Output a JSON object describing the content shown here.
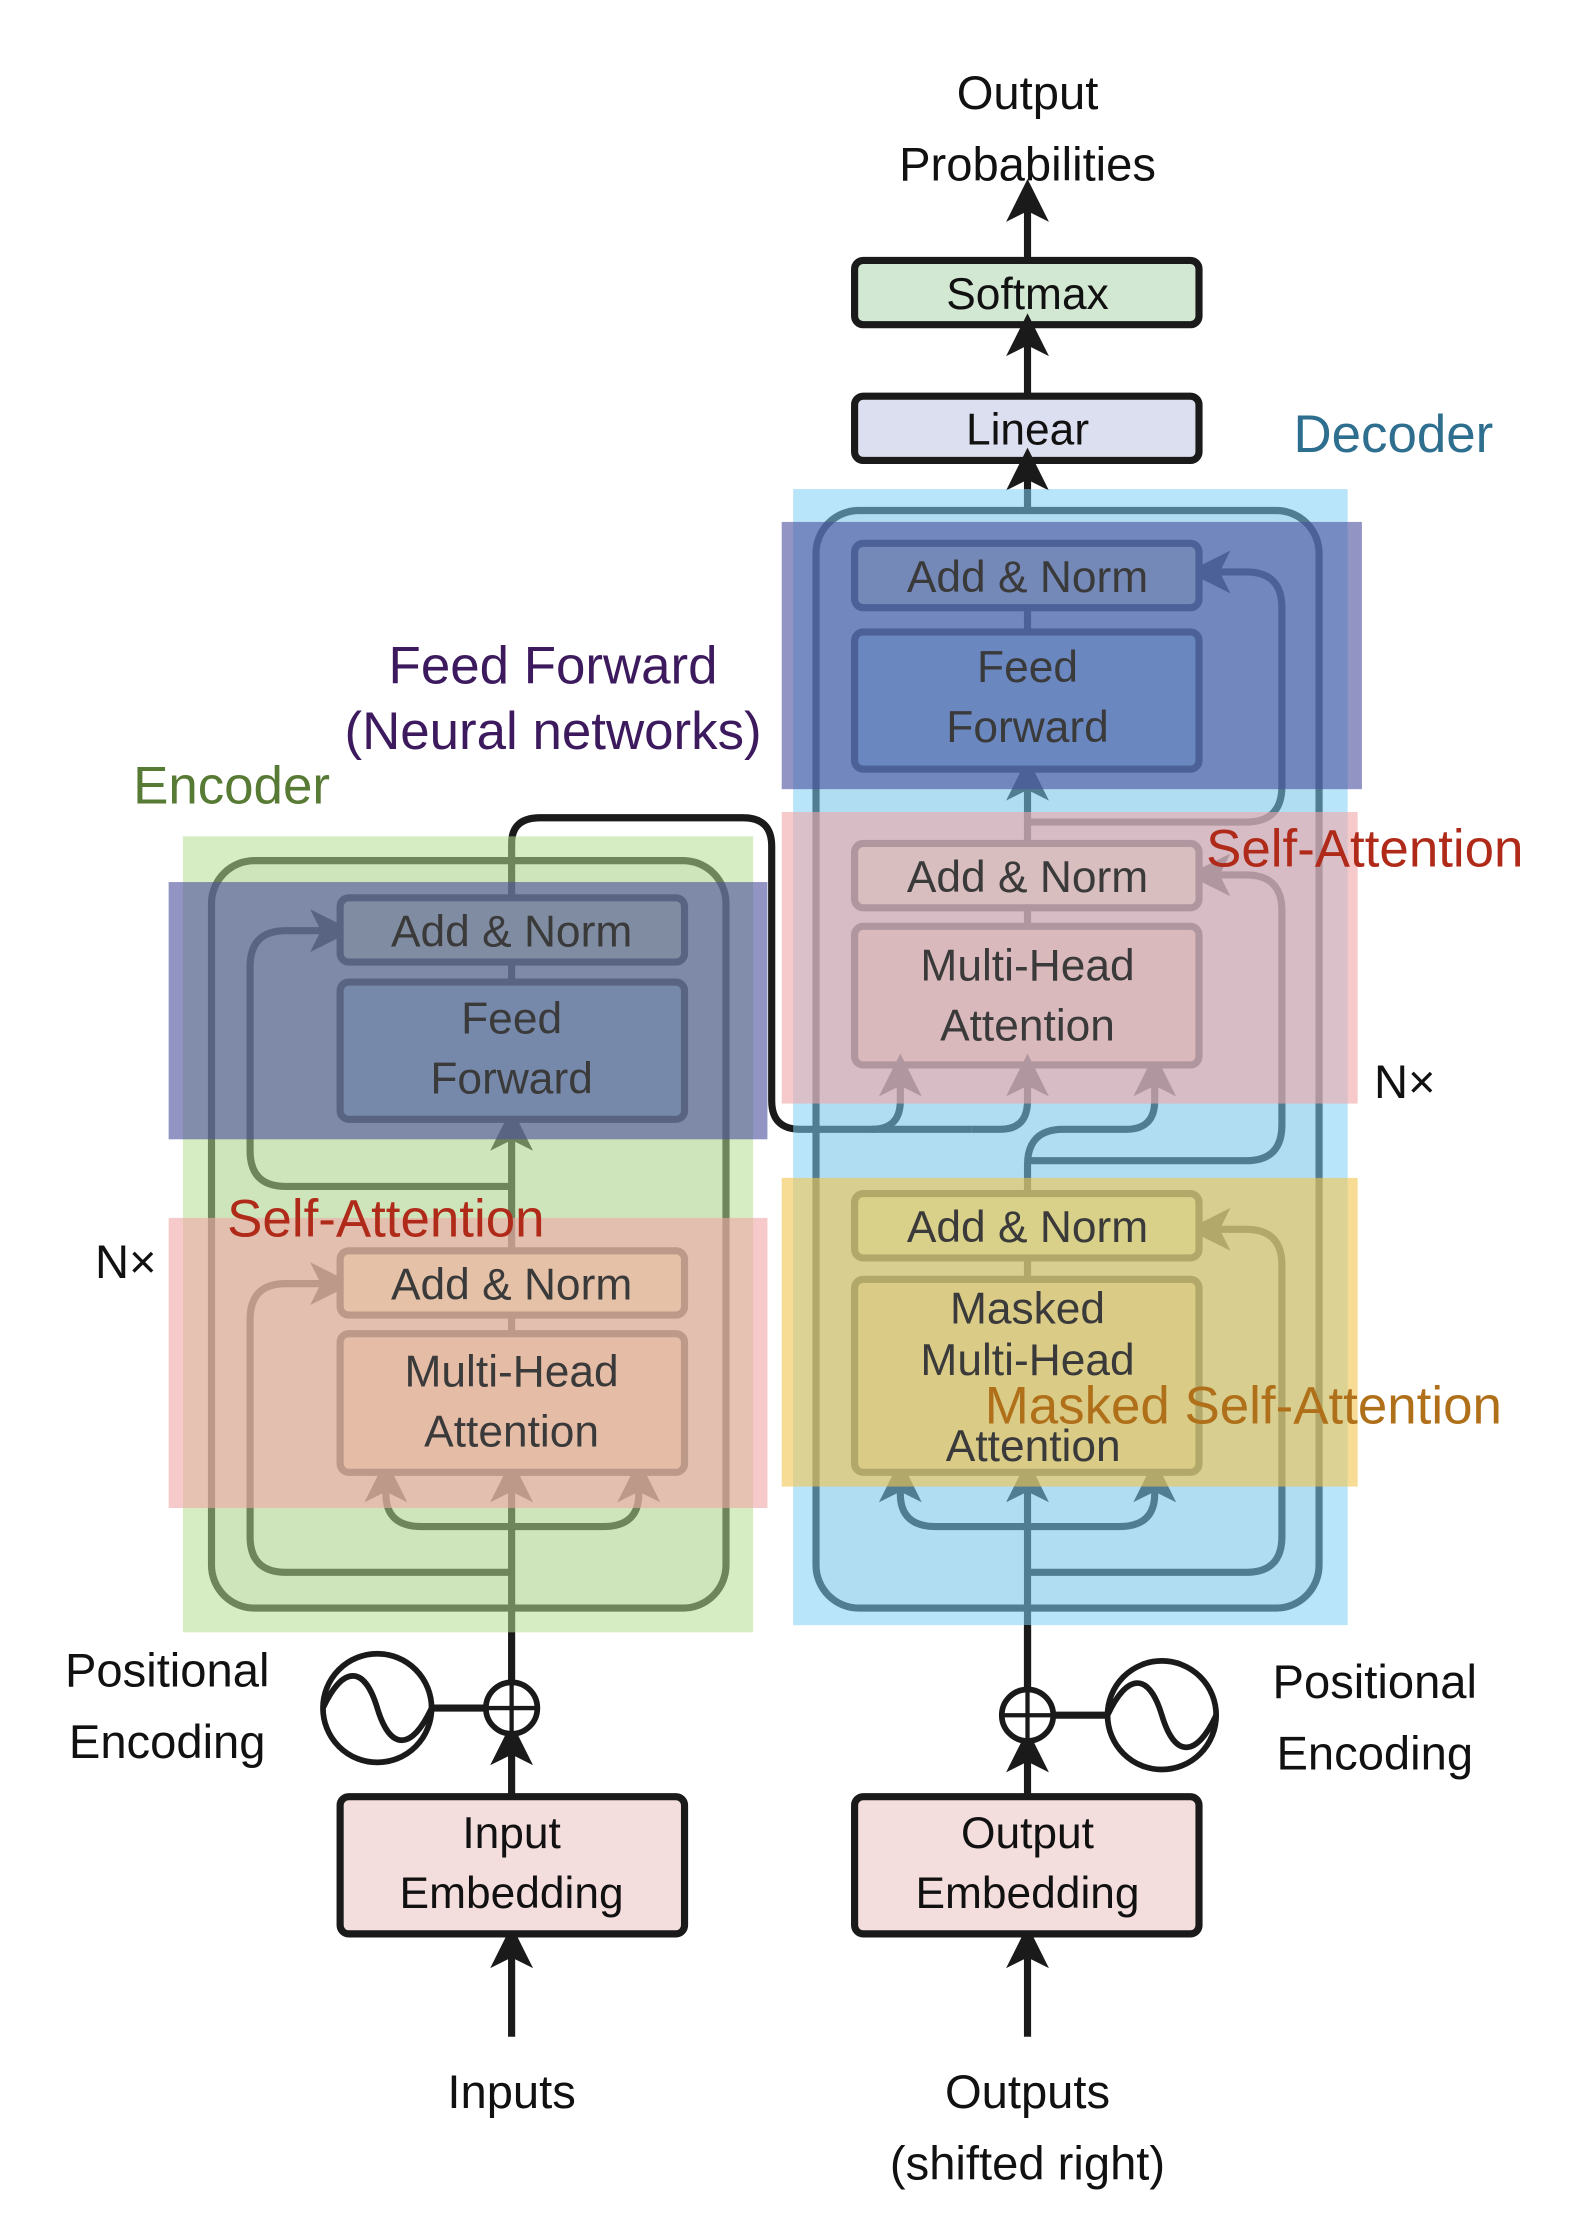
{
  "output_label": [
    "Output",
    "Probabilities"
  ],
  "softmax": "Softmax",
  "linear": "Linear",
  "encoder": {
    "add_norm_1": "Add & Norm",
    "multi_head": [
      "Multi-Head",
      "Attention"
    ],
    "add_norm_2": "Add & Norm",
    "feed_forward": [
      "Feed",
      "Forward"
    ],
    "embedding": [
      "Input",
      "Embedding"
    ],
    "input_label": "Inputs",
    "positional": [
      "Positional",
      "Encoding"
    ],
    "nx": "N×"
  },
  "decoder": {
    "add_norm_1": "Add & Norm",
    "masked_multi_head": [
      "Masked",
      "Multi-Head",
      "Attention"
    ],
    "add_norm_2": "Add & Norm",
    "multi_head": [
      "Multi-Head",
      "Attention"
    ],
    "add_norm_3": "Add & Norm",
    "feed_forward": [
      "Feed",
      "Forward"
    ],
    "embedding": [
      "Output",
      "Embedding"
    ],
    "output_label": [
      "Outputs",
      "(shifted right)"
    ],
    "positional": [
      "Positional",
      "Encoding"
    ],
    "nx": "N×"
  },
  "annotations": {
    "decoder": "Decoder",
    "encoder": "Encoder",
    "feed_forward": [
      "Feed Forward",
      "(Neural networks)"
    ],
    "self_attention_encoder": "Self-Attention",
    "self_attention_decoder": "Self-Attention",
    "masked_self_attention": "Masked Self-Attention"
  },
  "colors": {
    "encoder_region": "#c8e4ad",
    "decoder_region": "#8fd6f5",
    "feed_forward_region": "#4a4f9c",
    "self_attention_region": "#f0a6a6",
    "masked_region": "#f2c44e",
    "decoder_label": "#2e6e8e",
    "encoder_label": "#577a34",
    "ff_label": "#3d1a5e",
    "self_attention_label": "#b02a1a",
    "masked_label": "#b0701a"
  }
}
